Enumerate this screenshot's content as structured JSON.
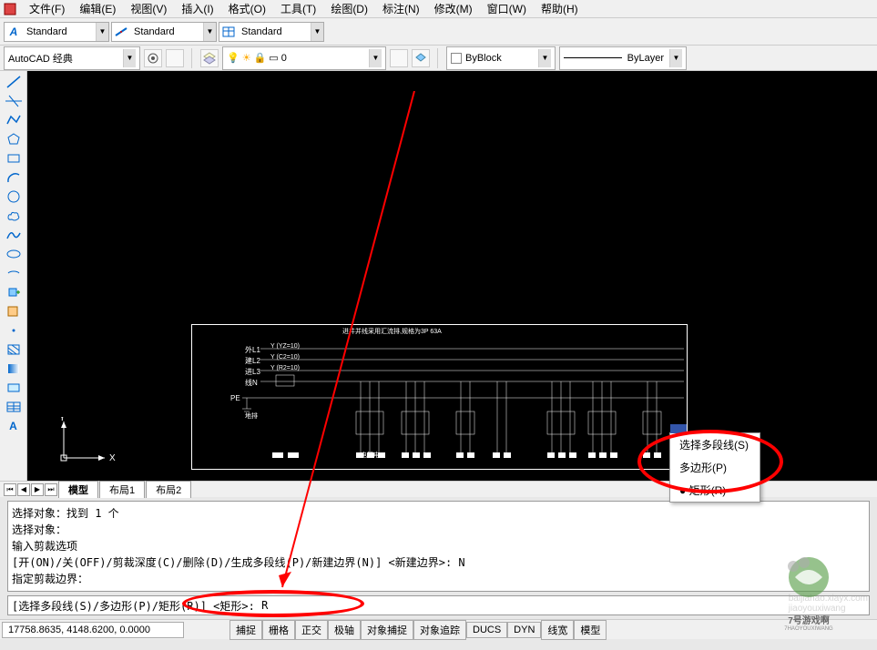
{
  "menubar": {
    "items": [
      {
        "label": "文件(F)"
      },
      {
        "label": "编辑(E)"
      },
      {
        "label": "视图(V)"
      },
      {
        "label": "插入(I)"
      },
      {
        "label": "格式(O)"
      },
      {
        "label": "工具(T)"
      },
      {
        "label": "绘图(D)"
      },
      {
        "label": "标注(N)"
      },
      {
        "label": "修改(M)"
      },
      {
        "label": "窗口(W)"
      },
      {
        "label": "帮助(H)"
      }
    ]
  },
  "style_toolbar": {
    "style1": "Standard",
    "style2": "Standard",
    "style3": "Standard"
  },
  "workspace": {
    "name": "AutoCAD 经典",
    "layer": "0",
    "color_prop": "ByBlock",
    "linetype": "ByLayer"
  },
  "tabs": {
    "items": [
      {
        "label": "模型",
        "active": true
      },
      {
        "label": "布局1",
        "active": false
      },
      {
        "label": "布局2",
        "active": false
      }
    ]
  },
  "command_history": {
    "lines": [
      "选择对象：找到 1 个",
      "选择对象：",
      "输入剪裁选项",
      "[开(ON)/关(OFF)/剪裁深度(C)/删除(D)/生成多段线(P)/新建边界(N)] <新建边界>: N",
      "指定剪裁边界："
    ]
  },
  "command_input": {
    "prompt": "[选择多段线(S)/多边形(P)/矩形(R)] <矩形>:",
    "value": "R"
  },
  "status": {
    "coords": "17758.8635, 4148.6200, 0.0000",
    "buttons": [
      {
        "label": "捕捉"
      },
      {
        "label": "栅格"
      },
      {
        "label": "正交"
      },
      {
        "label": "极轴"
      },
      {
        "label": "对象捕捉"
      },
      {
        "label": "对象追踪"
      },
      {
        "label": "DUCS"
      },
      {
        "label": "DYN"
      },
      {
        "label": "线宽"
      },
      {
        "label": "模型"
      }
    ]
  },
  "context_menu": {
    "items": [
      {
        "label": "选择多段线(S)",
        "selected": false
      },
      {
        "label": "多边形(P)",
        "selected": false
      },
      {
        "label": "矩形(R)",
        "selected": true
      }
    ]
  },
  "drawing_labels": {
    "title": "进井并线采用汇流排,规格为3P 63A",
    "n1": "外L1",
    "n2": "建L2",
    "n3": "进L3",
    "n4": "线N",
    "n5": "PE",
    "v1": "Y (YZ=10)",
    "v2": "Y (C2=10)",
    "v3": "Y (R2=10)",
    "ground": "地排",
    "cap": "电解电"
  },
  "ucs": {
    "x": "X",
    "y": "Y"
  },
  "watermark": {
    "site": "baijiahao.xiayx.com",
    "user": "jiaoyouxiwang",
    "brand_line1": "7号游戏啊",
    "brand_line2": "7HAOYOUXIWANG"
  }
}
